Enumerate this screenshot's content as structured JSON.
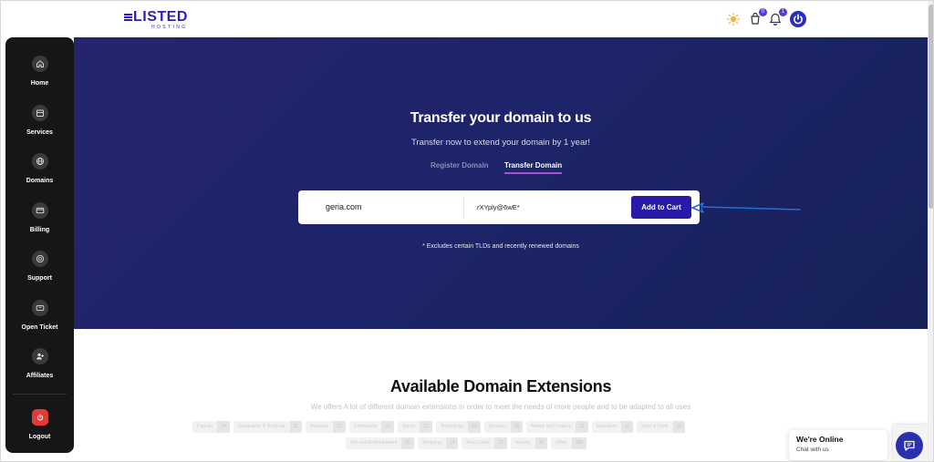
{
  "header": {
    "logo_text": "LISTED",
    "logo_sub": "HOSTING",
    "cart_count": "0",
    "notifications_count": "1"
  },
  "sidebar": {
    "items": [
      {
        "label": "Home",
        "icon": "home-icon"
      },
      {
        "label": "Services",
        "icon": "box-icon"
      },
      {
        "label": "Domains",
        "icon": "globe-icon"
      },
      {
        "label": "Billing",
        "icon": "credit-card-icon"
      },
      {
        "label": "Support",
        "icon": "support-icon"
      },
      {
        "label": "Open Ticket",
        "icon": "ticket-icon"
      },
      {
        "label": "Affiliates",
        "icon": "user-plus-icon"
      }
    ],
    "logout_label": "Logout"
  },
  "hero": {
    "title": "Transfer your domain to us",
    "subtitle": "Transfer now to extend your domain by 1 year!",
    "tabs": [
      {
        "label": "Register Domain",
        "active": false
      },
      {
        "label": "Transfer Domain",
        "active": true
      }
    ],
    "domain_value": "geria.com",
    "epp_value": "rXYply@6wE*",
    "add_to_cart_label": "Add to Cart",
    "note": "* Excludes certain TLDs and recently renewed domains"
  },
  "extensions": {
    "title": "Available Domain Extensions",
    "subtitle": "We offers A lot of different domain extensions in order to meet the needs of more people and to be adapted to all uses",
    "rows": [
      [
        {
          "name": "Popular",
          "count": "24"
        },
        {
          "name": "Geographic & Regional",
          "count": "51"
        },
        {
          "name": "Business",
          "count": "27"
        },
        {
          "name": "Community",
          "count": "21"
        },
        {
          "name": "Sports",
          "count": "15"
        },
        {
          "name": "Technology",
          "count": "23"
        },
        {
          "name": "Services",
          "count": "18"
        },
        {
          "name": "Money and Finance",
          "count": "21"
        },
        {
          "name": "Education",
          "count": "11"
        },
        {
          "name": "Food & Drink",
          "count": "15"
        }
      ],
      [
        {
          "name": "Arts and Entertainment",
          "count": "26"
        },
        {
          "name": "Shopping",
          "count": "14"
        },
        {
          "name": "Real Estate",
          "count": "15"
        },
        {
          "name": "Novelty",
          "count": "30"
        },
        {
          "name": "Other",
          "count": "100"
        }
      ]
    ]
  },
  "chat": {
    "status": "We're Online",
    "prompt": "Chat with us"
  },
  "colors": {
    "brand": "#2b1fb8",
    "hero_bg": "#1d2469",
    "sidebar_bg": "#161616",
    "cta": "#2a1aa8",
    "logout": "#e53935",
    "tab_underline": "#b14ad8"
  }
}
